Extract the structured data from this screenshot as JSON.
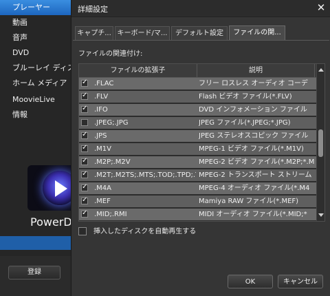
{
  "sidebar": {
    "items": [
      {
        "label": "プレーヤー",
        "active": true
      },
      {
        "label": "動画"
      },
      {
        "label": "音声"
      },
      {
        "label": "DVD"
      },
      {
        "label": "ブルーレイ ディス"
      },
      {
        "label": "ホーム メディア"
      },
      {
        "label": "MoovieLive"
      },
      {
        "label": "情報"
      }
    ],
    "brand_text": "PowerDVD",
    "register_label": "登録",
    "colors": {
      "active": "#2f7fd4",
      "strip": "#1f5fa8"
    }
  },
  "dialog": {
    "title": "詳細設定",
    "close_icon": "close-icon",
    "tabs": [
      {
        "label": "キャプチ..."
      },
      {
        "label": "キーボード/マ..."
      },
      {
        "label": "デフォルト設定"
      },
      {
        "label": "ファイルの関...",
        "active": true
      }
    ],
    "section_label": "ファイルの関連付け:",
    "table": {
      "columns": [
        "ファイルの拡張子",
        "説明"
      ],
      "rows": [
        {
          "checked": true,
          "ext": ".FLAC",
          "desc": "フリー ロスレス オーディオ コーデ"
        },
        {
          "checked": true,
          "ext": ".FLV",
          "desc": "Flash ビデオ ファイル(*.FLV)"
        },
        {
          "checked": true,
          "ext": ".IFO",
          "desc": "DVD インフォメーション ファイル"
        },
        {
          "checked": false,
          "ext": ".JPEG;.JPG",
          "desc": "JPEG ファイル(*.JPEG;*.JPG)"
        },
        {
          "checked": true,
          "ext": ".JPS",
          "desc": "JPEG ステレオスコピック ファイル"
        },
        {
          "checked": true,
          "ext": ".M1V",
          "desc": "MPEG-1 ビデオ ファイル(*.M1V)"
        },
        {
          "checked": true,
          "ext": ".M2P;.M2V",
          "desc": "MPEG-2 ビデオ ファイル(*.M2P;*.M"
        },
        {
          "checked": true,
          "ext": ".M2T;.M2TS;.MTS;.TOD;.TPD;.TR",
          "desc": "MPEG-2 トランスポート ストリーム"
        },
        {
          "checked": true,
          "ext": ".M4A",
          "desc": "MPEG-4 オーディオ ファイル(*.M4"
        },
        {
          "checked": true,
          "ext": ".MEF",
          "desc": "Mamiya RAW ファイル(*.MEF)"
        },
        {
          "checked": true,
          "ext": ".MID;.RMI",
          "desc": "MIDI オーディオ ファイル(*.MID;*"
        }
      ]
    },
    "autoplay_label": "挿入したディスクを自動再生する",
    "autoplay_checked": false,
    "ok_label": "OK",
    "cancel_label": "キャンセル"
  }
}
